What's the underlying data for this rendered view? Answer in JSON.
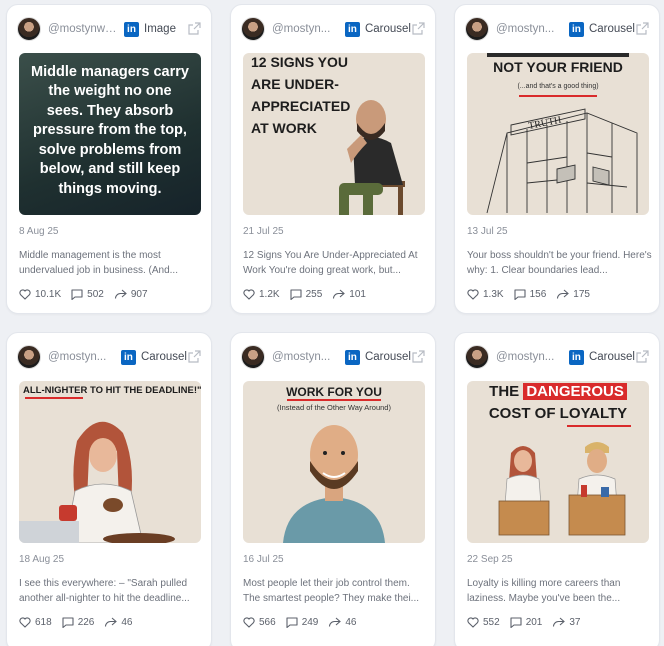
{
  "cards": [
    {
      "handle": "@mostynwil...",
      "type": "Image",
      "image_text": "Middle managers carry the weight no one sees. They absorb pressure from the top, solve problems from below, and still keep things moving.",
      "date": "8 Aug 25",
      "description": "Middle management is the most undervalued job in business. (And...",
      "likes": "10.1K",
      "comments": "502",
      "shares": "907"
    },
    {
      "handle": "@mostyn...",
      "type": "Carousel",
      "image_text": "12 SIGNS YOU ARE UNDER-APPRECIATED AT WORK",
      "date": "21 Jul 25",
      "description": "12 Signs You Are Under-Appreciated At Work You're doing great work, but...",
      "likes": "1.2K",
      "comments": "255",
      "shares": "101"
    },
    {
      "handle": "@mostyn...",
      "type": "Carousel",
      "image_text": "NOT YOUR FRIEND",
      "image_subtext": "(...and that's a good thing)",
      "image_sign": "TRUTH",
      "date": "13 Jul 25",
      "description": "Your boss shouldn't be your friend. Here's why:  1. Clear boundaries lead...",
      "likes": "1.3K",
      "comments": "156",
      "shares": "175"
    },
    {
      "handle": "@mostyn...",
      "type": "Carousel",
      "image_text": "ALL-NIGHTER TO HIT THE DEADLINE!\"",
      "date": "18 Aug 25",
      "description": "I see this everywhere:  – \"Sarah pulled another all-nighter to hit the deadline...",
      "likes": "618",
      "comments": "226",
      "shares": "46"
    },
    {
      "handle": "@mostyn...",
      "type": "Carousel",
      "image_text": "WORK FOR YOU",
      "image_subtext": "(Instead of the Other Way Around)",
      "date": "16 Jul 25",
      "description": "Most people let their job control them. The smartest people? They make thei...",
      "likes": "566",
      "comments": "249",
      "shares": "46"
    },
    {
      "handle": "@mostyn...",
      "type": "Carousel",
      "image_text_1": "THE",
      "image_text_2": "DANGEROUS",
      "image_text_3": "COST OF LOYALTY",
      "date": "22 Sep 25",
      "description": "Loyalty is killing more careers than laziness. Maybe you've been the...",
      "likes": "552",
      "comments": "201",
      "shares": "37"
    }
  ],
  "icons": {
    "linkedin_label": "in",
    "external": "external-link-icon"
  },
  "colors": {
    "linkedin": "#0a66c2",
    "accent_red": "#d92b2b"
  }
}
